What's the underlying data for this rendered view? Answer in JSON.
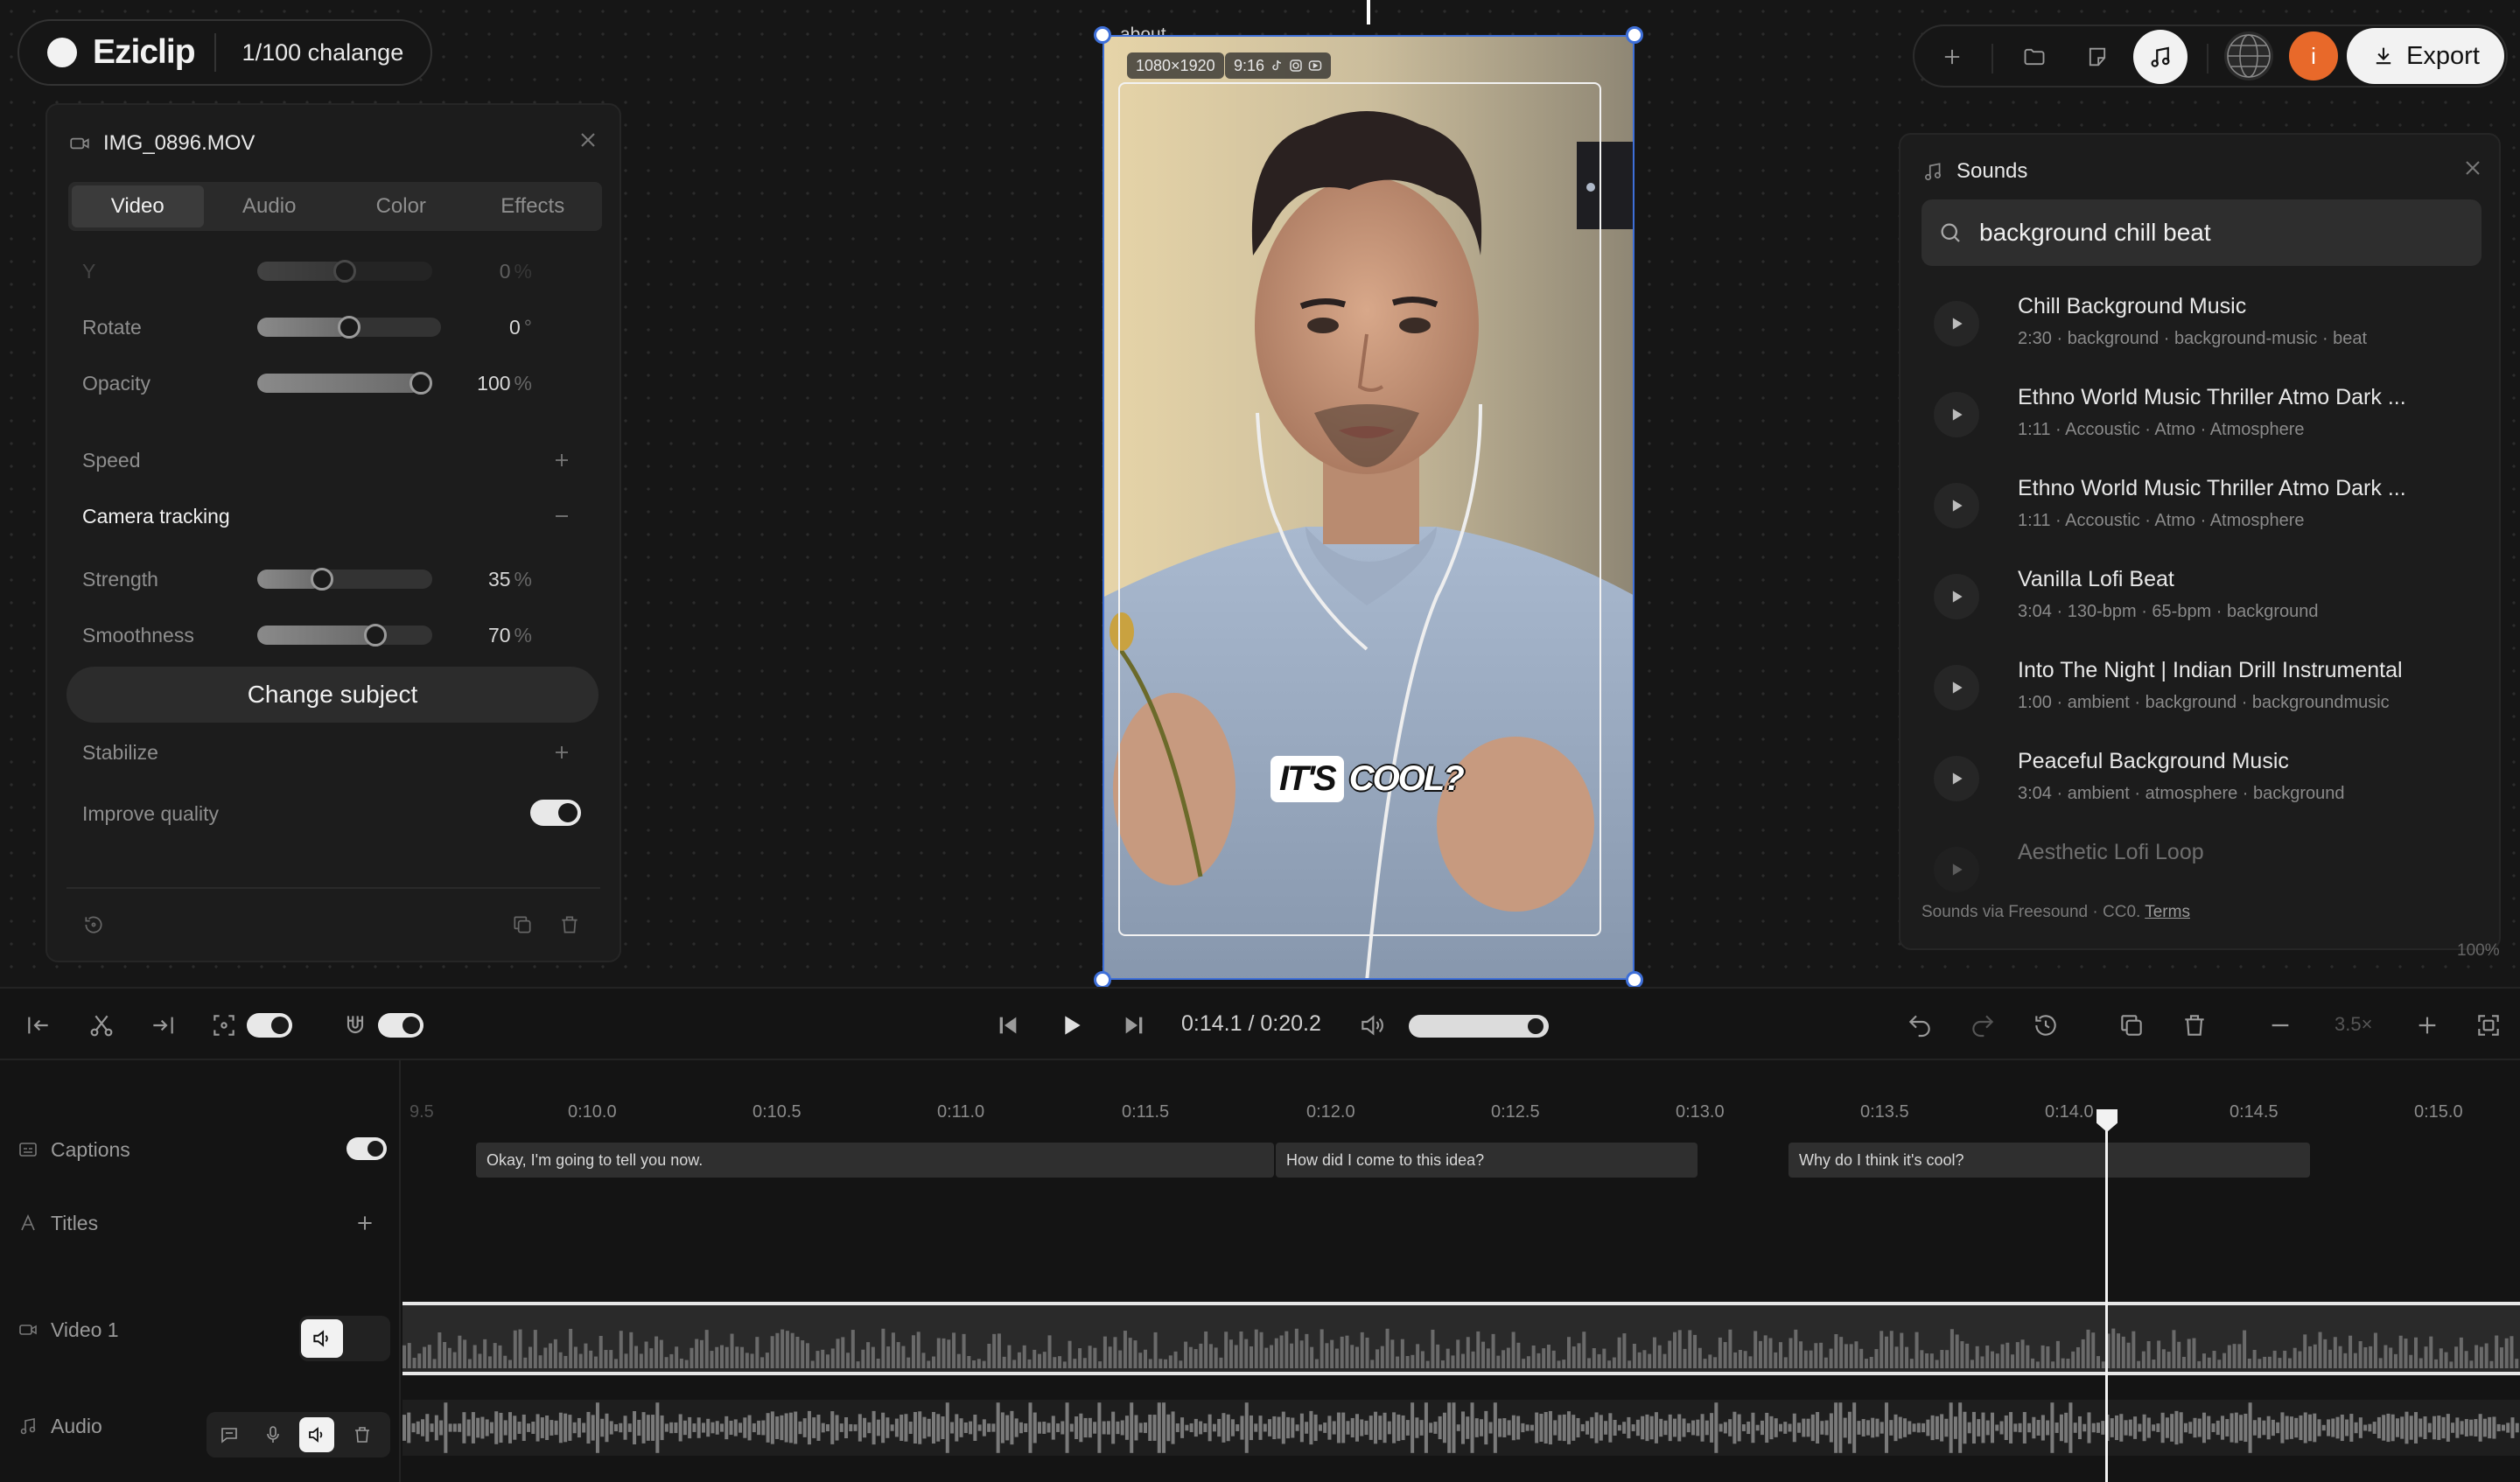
{
  "brand": {
    "name": "Eziclip",
    "project": "1/100 chalange"
  },
  "clip_panel": {
    "filename": "IMG_0896.MOV",
    "tabs": [
      "Video",
      "Audio",
      "Color",
      "Effects"
    ],
    "active_tab": "Video",
    "y": {
      "label": "Y",
      "value": "0",
      "unit": "%",
      "level": 0.5
    },
    "rotate": {
      "label": "Rotate",
      "value": "0",
      "unit": "°",
      "level": 0.5
    },
    "opacity": {
      "label": "Opacity",
      "value": "100",
      "unit": "%",
      "level": 1.0
    },
    "speed_label": "Speed",
    "camera_tracking_label": "Camera tracking",
    "strength": {
      "label": "Strength",
      "value": "35",
      "unit": "%",
      "level": 0.35
    },
    "smoothness": {
      "label": "Smoothness",
      "value": "70",
      "unit": "%",
      "level": 0.7
    },
    "change_subject_label": "Change subject",
    "stabilize_label": "Stabilize",
    "improve_quality_label": "Improve quality",
    "improve_quality_on": true
  },
  "preview": {
    "element_label": "about",
    "resolution": "1080×1920",
    "aspect": "9:16",
    "caption_word1": "IT'S",
    "caption_word2": "COOL?",
    "zoom": "100%"
  },
  "toolbar": {
    "export_label": "Export",
    "avatar_letter": "i",
    "avatar_color": "#e8692a"
  },
  "sounds": {
    "title": "Sounds",
    "query": "background chill beat",
    "items": [
      {
        "title": "Chill Background Music",
        "meta": "2:30 · background · background-music · beat"
      },
      {
        "title": "Ethno World Music Thriller Atmo Dark ...",
        "meta": "1:11 · Accoustic · Atmo · Atmosphere"
      },
      {
        "title": "Ethno World Music Thriller Atmo Dark ...",
        "meta": "1:11 · Accoustic · Atmo · Atmosphere"
      },
      {
        "title": "Vanilla Lofi Beat",
        "meta": "3:04 · 130-bpm · 65-bpm · background"
      },
      {
        "title": "Into The Night | Indian Drill Instrumental",
        "meta": "1:00 · ambient · background · backgroundmusic"
      },
      {
        "title": "Peaceful Background Music",
        "meta": "3:04 · ambient · atmosphere · background"
      },
      {
        "title": "Aesthetic Lofi Loop",
        "meta": ""
      }
    ],
    "footer_prefix": "Sounds via Freesound · CC0. ",
    "footer_link": "Terms"
  },
  "transport": {
    "time": "0:14.1 / 0:20.2",
    "zoom": "3.5×",
    "volume_level": 0.9
  },
  "timeline": {
    "ruler": [
      "9.5",
      "0:10.0",
      "0:10.5",
      "0:11.0",
      "0:11.5",
      "0:12.0",
      "0:12.5",
      "0:13.0",
      "0:13.5",
      "0:14.0",
      "0:14.5",
      "0:15.0"
    ],
    "tracks": {
      "captions": "Captions",
      "titles": "Titles",
      "video": "Video 1",
      "audio": "Audio"
    },
    "captions": [
      "Okay, I'm going to tell you now.",
      "How did I come to this idea?",
      "Why do I think it's cool?"
    ]
  }
}
